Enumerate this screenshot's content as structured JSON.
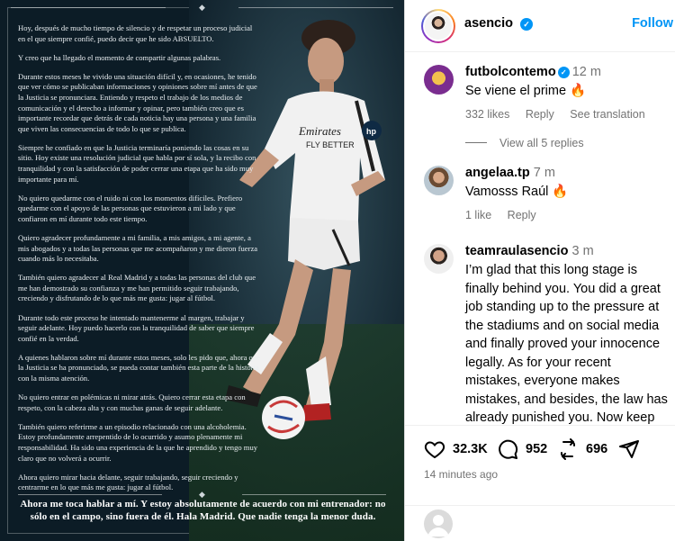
{
  "post": {
    "letter": [
      "Hoy, después de mucho tiempo de silencio y de respetar un proceso judicial en el que siempre confié, puedo decir que he sido ABSUELTO.",
      "Y creo que ha llegado el momento de compartir algunas palabras.",
      "Durante estos meses he vivido una situación difícil y, en ocasiones, he tenido que ver cómo se publicaban informaciones y opiniones sobre mí antes de que la Justicia se pronunciara. Entiendo y respeto el trabajo de los medios de comunicación y el derecho a informar y opinar, pero también creo que es importante recordar que detrás de cada noticia hay una persona y una familia que viven las consecuencias de todo lo que se publica.",
      "Siempre he confiado en que la Justicia terminaría poniendo las cosas en su sitio. Hoy existe una resolución judicial que habla por sí sola, y la recibo con tranquilidad y con la satisfacción de poder cerrar una etapa que ha sido muy importante para mí.",
      "No quiero quedarme con el ruido ni con los momentos difíciles. Prefiero quedarme con el apoyo de las personas que estuvieron a mi lado y que confiaron en mí durante todo este tiempo.",
      "Quiero agradecer profundamente a mi familia, a mis amigos, a mi agente, a mis abogados y a todas las personas que me acompañaron y me dieron fuerza cuando más lo necesitaba.",
      "También quiero agradecer al Real Madrid y a todas las personas del club que me han demostrado su confianza y me han permitido seguir trabajando, creciendo y disfrutando de lo que más me gusta: jugar al fútbol.",
      "Durante todo este proceso he intentado mantenerme al margen, trabajar y seguir adelante. Hoy puedo hacerlo con la tranquilidad de saber que siempre confié en la verdad.",
      "A quienes hablaron sobre mí durante estos meses, solo les pido que, ahora que la Justicia se ha pronunciado, se pueda contar también esta parte de la historia con la misma atención.",
      "No quiero entrar en polémicas ni mirar atrás. Quiero cerrar esta etapa con respeto, con la cabeza alta y con muchas ganas de seguir adelante.",
      "También quiero referirme a un episodio relacionado con una alcoholemia. Estoy profundamente arrepentido de lo ocurrido y asumo plenamente mi responsabilidad. Ha sido una experiencia de la que he aprendido y tengo muy claro que no volverá a ocurrir.",
      "Ahora quiero mirar hacia delante, seguir trabajando, seguir creciendo y centrarme en lo que más me gusta: jugar al fútbol."
    ],
    "closing": "Ahora me toca hablar a mí. Y estoy absolutamente de acuerdo con mi entrenador: no sólo en el campo, sino fuera de él. Hala Madrid. Que nadie tenga la menor duda."
  },
  "header": {
    "username": "asencio",
    "follow_label": "Follow"
  },
  "comments": [
    {
      "username": "futbolcontemo",
      "verified": true,
      "time": "12 m",
      "text": "Se viene el prime 🔥",
      "likes": "332 likes",
      "reply": "Reply",
      "translate": "See translation",
      "view_replies": "View all 5 replies"
    },
    {
      "username": "angelaa.tp",
      "time": "7 m",
      "text": "Vamosss Raúl 🔥",
      "likes": "1 like",
      "reply": "Reply"
    },
    {
      "username": "teamraulasencio",
      "time": "3 m",
      "text": "I’m glad that this long stage is finally behind you. You did a great job standing up to the pressure at the stadiums and on social media and finally proved your innocence legally. As for your recent mistakes, everyone makes mistakes, and besides, the law has already punished you. Now keep improving, and we’ll keep"
    }
  ],
  "actions": {
    "likes": "32.3K",
    "comments": "952",
    "reposts": "696",
    "posted_ago": "14 minutes ago"
  },
  "colors": {
    "accent": "#0095f6",
    "muted": "#737373",
    "post_bg": "#0c1c26"
  }
}
